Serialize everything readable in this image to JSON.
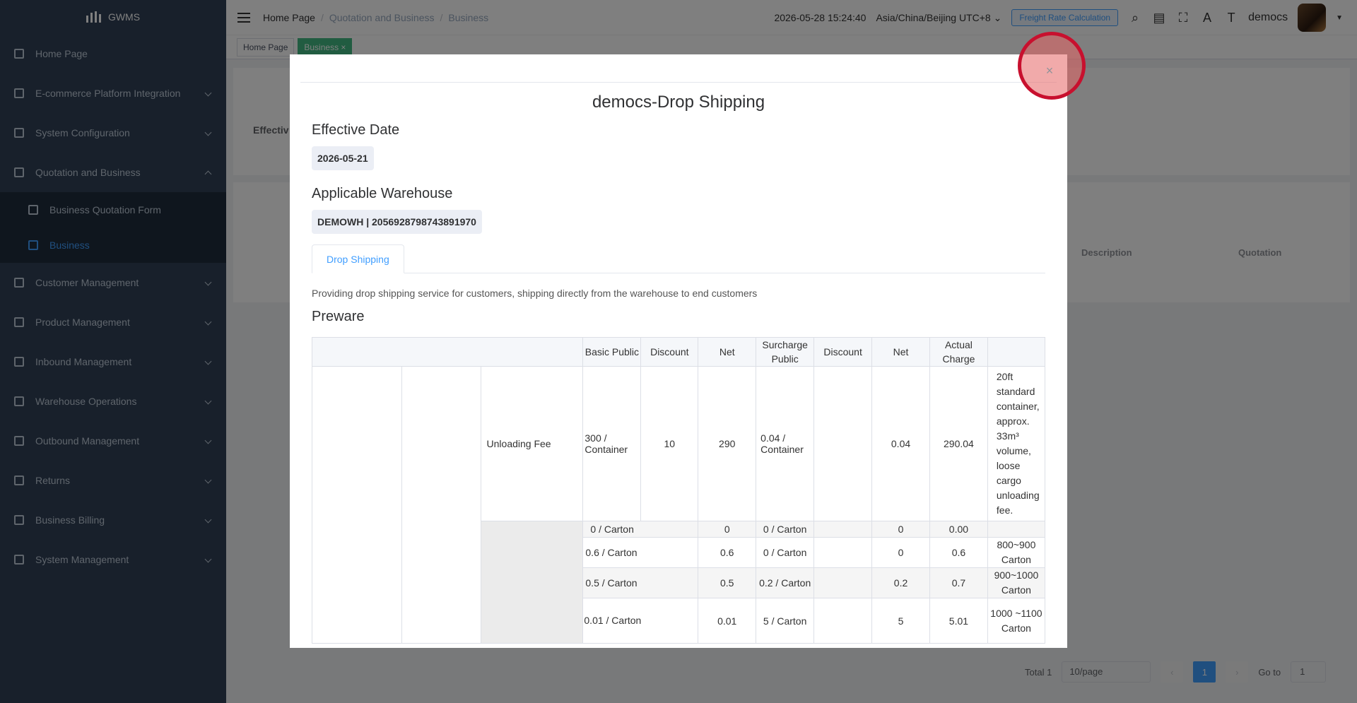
{
  "app": {
    "name": "GWMS"
  },
  "sidebar": {
    "items": [
      {
        "label": "Home Page"
      },
      {
        "label": "E-commerce Platform Integration"
      },
      {
        "label": "System Configuration"
      },
      {
        "label": "Quotation and Business"
      },
      {
        "label": "Customer Management"
      },
      {
        "label": "Product Management"
      },
      {
        "label": "Inbound Management"
      },
      {
        "label": "Warehouse Operations"
      },
      {
        "label": "Outbound Management"
      },
      {
        "label": "Returns"
      },
      {
        "label": "Business Billing"
      },
      {
        "label": "System Management"
      }
    ],
    "sub_items": [
      {
        "label": "Business Quotation Form"
      },
      {
        "label": "Business"
      }
    ]
  },
  "header": {
    "breadcrumb": [
      "Home Page",
      "Quotation and Business",
      "Business"
    ],
    "datetime": "2026-05-28 15:24:40",
    "timezone": "Asia/China/Beijing UTC+8",
    "freight_button": "Freight Rate Calculation",
    "username": "democs"
  },
  "tags": [
    "Home Page",
    "Business"
  ],
  "background": {
    "effective_label": "Effectiv",
    "col_description": "Description",
    "col_quotation": "Quotation",
    "pagination": {
      "total": "Total 1",
      "page_size": "10/page",
      "page": "1",
      "goto_label": "Go to",
      "goto_value": "1"
    }
  },
  "modal": {
    "title": "democs-Drop Shipping",
    "effective_date_label": "Effective Date",
    "effective_date": "2026-05-21",
    "warehouse_label": "Applicable Warehouse",
    "warehouse": "DEMOWH | 2056928798743891970",
    "tab": "Drop Shipping",
    "description": "Providing drop shipping service for customers, shipping directly from the warehouse to end customers",
    "section": "Preware",
    "table": {
      "headers": [
        "Basic Public",
        "Discount",
        "Net",
        "Surcharge Public",
        "Discount",
        "Net",
        "Actual Charge"
      ],
      "unloading": {
        "name": "Unloading Fee",
        "basic": "300 / Container",
        "discount": "10",
        "net": "290",
        "surcharge": "0.04 / Container",
        "discount2": "",
        "net2": "0.04",
        "actual": "290.04",
        "note": "20ft standard container, approx. 33m³ volume, loose cargo unloading fee."
      },
      "tiers": [
        {
          "basic": "0 / Carton",
          "net": "0",
          "surcharge": "0 / Carton",
          "net2": "0",
          "actual": "0.00",
          "note": ""
        },
        {
          "basic": "0.6 / Carton",
          "net": "0.6",
          "surcharge": "0 / Carton",
          "net2": "0",
          "actual": "0.6",
          "note": "800~900 Carton"
        },
        {
          "basic": "0.5 / Carton",
          "net": "0.5",
          "surcharge": "0.2 / Carton",
          "net2": "0.2",
          "actual": "0.7",
          "note": "900~1000 Carton"
        },
        {
          "basic": "0.01 / Carton",
          "net": "0.01",
          "surcharge": "5 / Carton",
          "net2": "5",
          "actual": "5.01",
          "note": "1000 ~1100 Carton"
        }
      ]
    }
  }
}
